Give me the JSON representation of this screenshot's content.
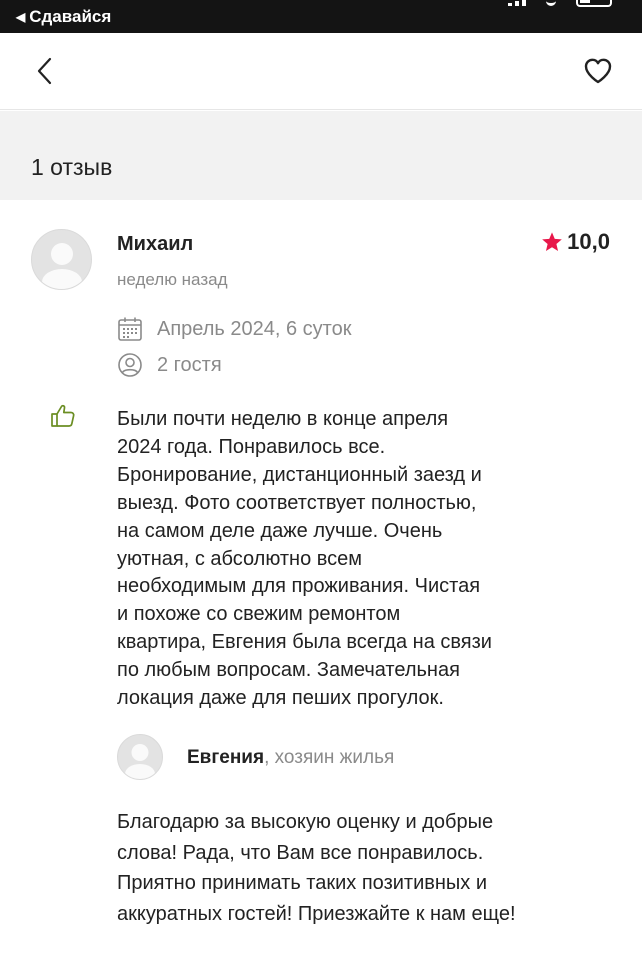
{
  "status_bar": {
    "back_app_label": "Сдавайся"
  },
  "nav": {
    "back_icon": "chevron-left-icon",
    "favorite_icon": "heart-icon"
  },
  "header": {
    "reviews_count": "1 отзыв"
  },
  "review": {
    "author": "Михаил",
    "rating": "10,0",
    "rating_color": "#e8184a",
    "date": "неделю назад",
    "stay_dates": "Апрель 2024, 6 суток",
    "guests": "2 гостя",
    "like_icon_color": "#6b8e23",
    "text_lines": [
      "Были почти неделю в конце апреля",
      "2024 года. Понравилось все.",
      "Бронирование, дистанционный заезд и",
      "выезд. Фото соответствует полностью,",
      "на самом деле даже лучше. Очень",
      "уютная, с абсолютно всем",
      "необходимым для проживания. Чистая",
      "и похоже со свежим ремонтом",
      "квартира, Евгения была всегда на связи",
      "по любым вопросам. Замечательная",
      "локация даже для пеших прогулок."
    ],
    "owner_reply": {
      "name": "Евгения",
      "role": ", хозяин жилья",
      "text_lines": [
        "Благодарю за высокую оценку и добрые",
        "слова! Рада, что Вам все понравилось.",
        "Приятно принимать таких позитивных и",
        "аккуратных гостей! Приезжайте к нам еще!"
      ]
    }
  }
}
